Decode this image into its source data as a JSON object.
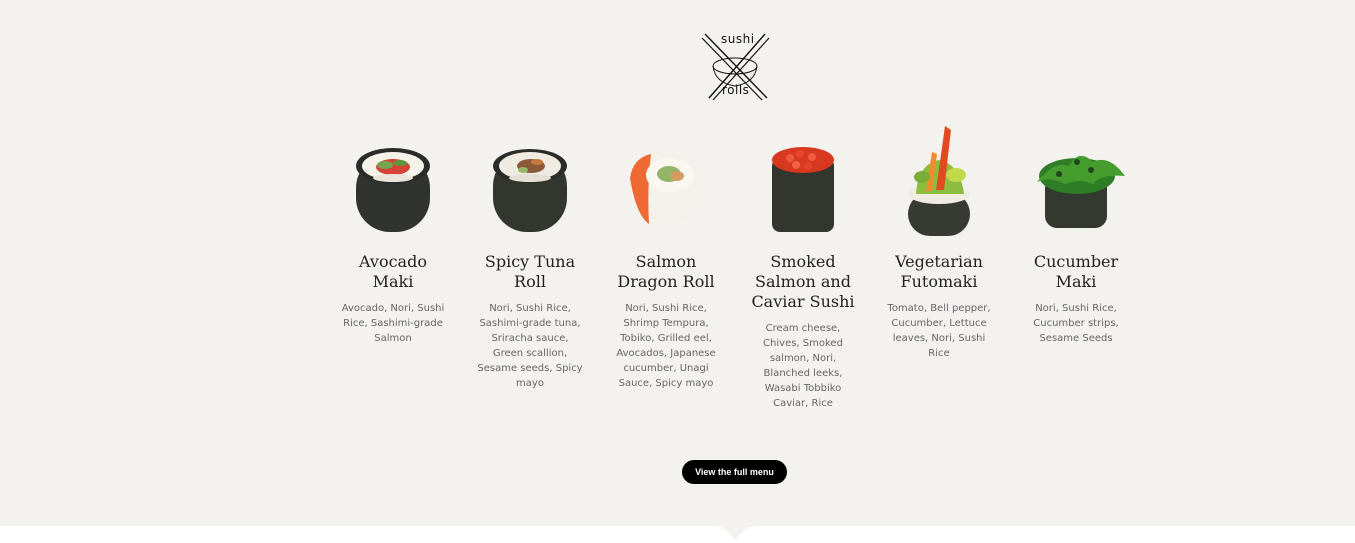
{
  "logo": {
    "top_text": "sushi",
    "bottom_text": "rolls"
  },
  "menu": {
    "items": [
      {
        "name": "Avocado Maki",
        "description": "Avocado, Nori, Sushi Rice, Sashimi-grade Salmon",
        "image": "avocado-maki-image"
      },
      {
        "name": "Spicy Tuna Roll",
        "description": "Nori, Sushi Rice, Sashimi-grade tuna, Sriracha sauce, Green scallion, Sesame seeds, Spicy mayo",
        "image": "spicy-tuna-roll-image"
      },
      {
        "name": "Salmon Dragon Roll",
        "description": "Nori, Sushi Rice, Shrimp Tempura, Tobiko, Grilled eel, Avocados, Japanese cucumber, Unagi Sauce, Spicy mayo",
        "image": "salmon-dragon-roll-image"
      },
      {
        "name": "Smoked Salmon and Caviar Sushi",
        "description": "Cream cheese, Chives, Smoked salmon, Nori, Blanched leeks, Wasabi Tobbiko Caviar, Rice",
        "image": "smoked-salmon-caviar-sushi-image"
      },
      {
        "name": "Vegetarian Futomaki",
        "description": "Tomato, Bell pepper, Cucumber, Lettuce leaves, Nori, Sushi Rice",
        "image": "vegetarian-futomaki-image"
      },
      {
        "name": "Cucumber Maki",
        "description": "Nori, Sushi Rice, Cucumber strips, Sesame Seeds",
        "image": "cucumber-maki-image"
      }
    ],
    "button_label": "View the full menu"
  },
  "colors": {
    "background": "#f3f2ef",
    "button": "#000000",
    "button_text": "#ffffff",
    "title_text": "#222222",
    "description_text": "#666666",
    "bottom_band": "#ffffff"
  }
}
